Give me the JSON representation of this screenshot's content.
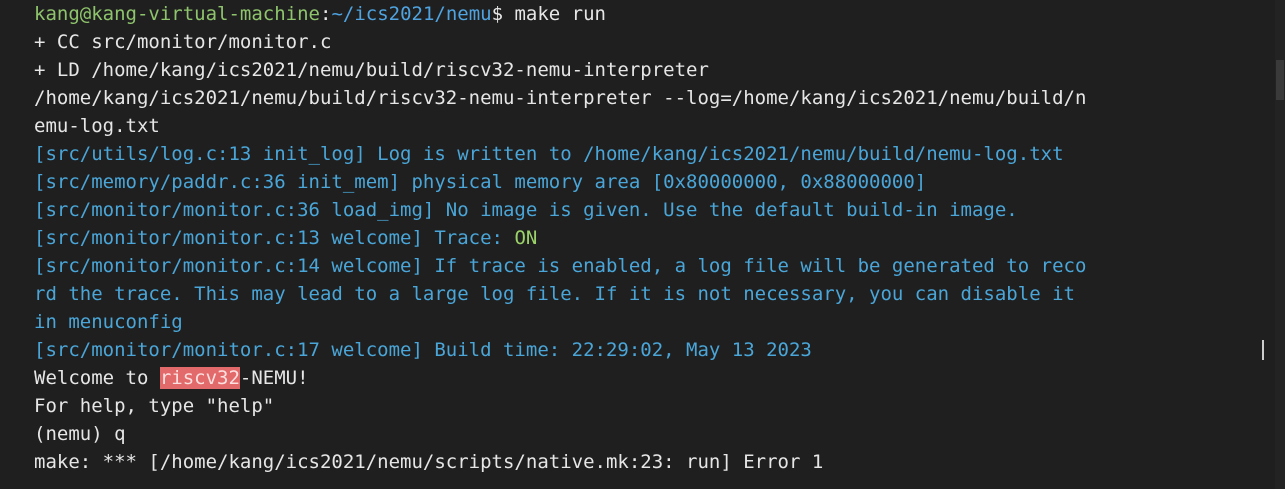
{
  "terminal": {
    "prompt_user": "kang@kang-virtual-machine",
    "prompt_sep": ":",
    "prompt_path": "~/ics2021/nemu",
    "prompt_symbol": "$ ",
    "command": "make run",
    "cc_line": "+ CC src/monitor/monitor.c",
    "ld_line": "+ LD /home/kang/ics2021/nemu/build/riscv32-nemu-interpreter",
    "exec_line1": "/home/kang/ics2021/nemu/build/riscv32-nemu-interpreter --log=/home/kang/ics2021/nemu/build/n",
    "exec_line2": "emu-log.txt",
    "log1": "[src/utils/log.c:13 init_log] Log is written to /home/kang/ics2021/nemu/build/nemu-log.txt",
    "log2": "[src/memory/paddr.c:36 init_mem] physical memory area [0x80000000, 0x88000000]",
    "log3": "[src/monitor/monitor.c:36 load_img] No image is given. Use the default build-in image.",
    "log4_prefix": "[src/monitor/monitor.c:13 welcome] Trace: ",
    "log4_value": "ON",
    "log5a": "[src/monitor/monitor.c:14 welcome] If trace is enabled, a log file will be generated to reco",
    "log5b": "rd the trace. This may lead to a large log file. If it is not necessary, you can disable it",
    "log5c": "in menuconfig",
    "log6": "[src/monitor/monitor.c:17 welcome] Build time: 22:29:02, May 13 2023",
    "welcome_prefix": "Welcome to ",
    "welcome_highlight": "riscv32",
    "welcome_suffix": "-NEMU!",
    "help_line": "For help, type \"help\"",
    "nemu_prompt": "(nemu) q",
    "error_line": "make: *** [/home/kang/ics2021/nemu/scripts/native.mk:23: run] Error 1"
  },
  "colors": {
    "background": "#1f1f1f",
    "text": "#e6e6e6",
    "user": "#8ec46c",
    "path": "#4fa3e0",
    "log": "#4aa6d8",
    "on": "#9bd36a",
    "highlight": "#e26a6a"
  }
}
